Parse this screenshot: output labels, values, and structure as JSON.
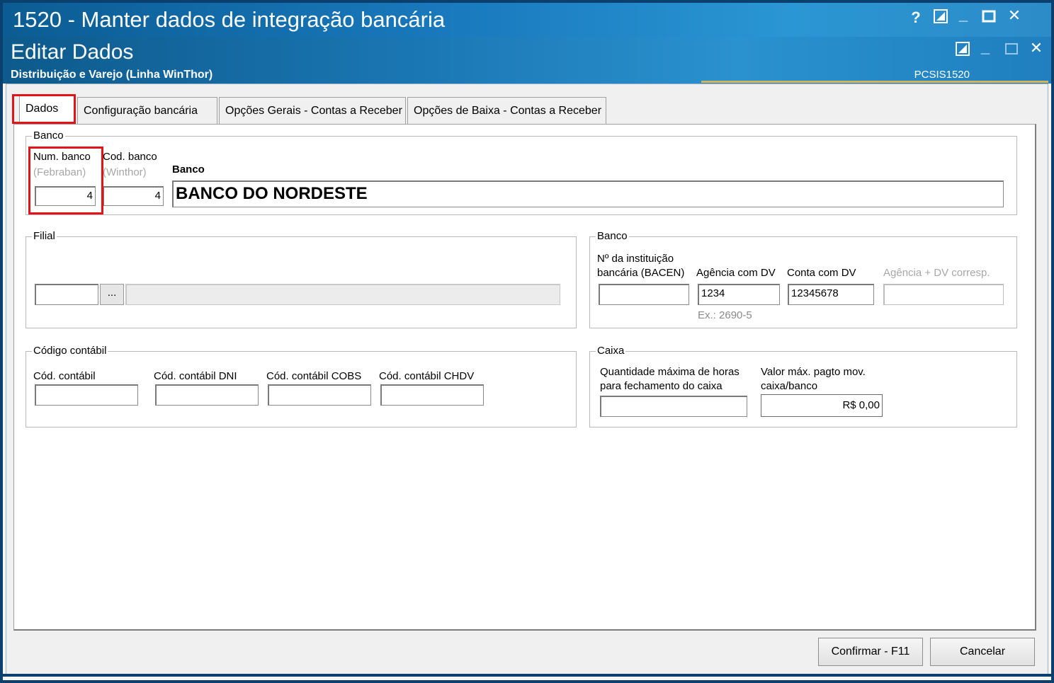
{
  "window": {
    "title": "1520 - Manter dados de integração bancária",
    "help_label": "?",
    "minimize_label": "_",
    "maximize_label": "□",
    "close_label": "✕"
  },
  "subwindow": {
    "title": "Editar Dados",
    "subtitle": "Distribuição e Varejo (Linha WinThor)",
    "code": "PCSIS1520"
  },
  "tabs": [
    {
      "label": "Dados"
    },
    {
      "label": "Configuração bancária"
    },
    {
      "label": "Opções Gerais - Contas a Receber"
    },
    {
      "label": "Opções de Baixa - Contas a Receber"
    }
  ],
  "banco_group": {
    "title": "Banco",
    "num_banco_label": "Num. banco",
    "num_banco_sub": "(Febraban)",
    "num_banco_value": "4",
    "cod_banco_label": "Cod. banco",
    "cod_banco_sub": "(Winthor)",
    "cod_banco_value": "4",
    "banco_label": "Banco",
    "banco_value": "BANCO DO NORDESTE"
  },
  "filial_group": {
    "title": "Filial",
    "code_value": "",
    "browse_label": "...",
    "name_value": ""
  },
  "banco_info_group": {
    "title": "Banco",
    "instituicao_label_1": "Nº da instituição",
    "instituicao_label_2": "bancária (BACEN)",
    "instituicao_value": "",
    "agencia_label": "Agência com DV",
    "agencia_value": "1234",
    "agencia_hint": "Ex.: 2690-5",
    "conta_label": "Conta com DV",
    "conta_value": "12345678",
    "agencia_corresp_label": "Agência + DV corresp.",
    "agencia_corresp_value": ""
  },
  "codigo_contabil_group": {
    "title": "Código contábil",
    "fields": [
      {
        "label": "Cód. contábil",
        "value": ""
      },
      {
        "label": "Cód. contábil DNI",
        "value": ""
      },
      {
        "label": "Cód. contábil COBS",
        "value": ""
      },
      {
        "label": "Cód. contábil CHDV",
        "value": ""
      }
    ]
  },
  "caixa_group": {
    "title": "Caixa",
    "horas_label_1": "Quantidade máxima de horas",
    "horas_label_2": "para fechamento do caixa",
    "horas_value": "",
    "valor_label_1": "Valor máx. pagto mov.",
    "valor_label_2": "caixa/banco",
    "valor_value": "R$ 0,00"
  },
  "footer": {
    "confirm_label": "Confirmar - F11",
    "cancel_label": "Cancelar"
  },
  "colors": {
    "highlight": "#e1141b",
    "titlebar": "#1a7bbf"
  }
}
